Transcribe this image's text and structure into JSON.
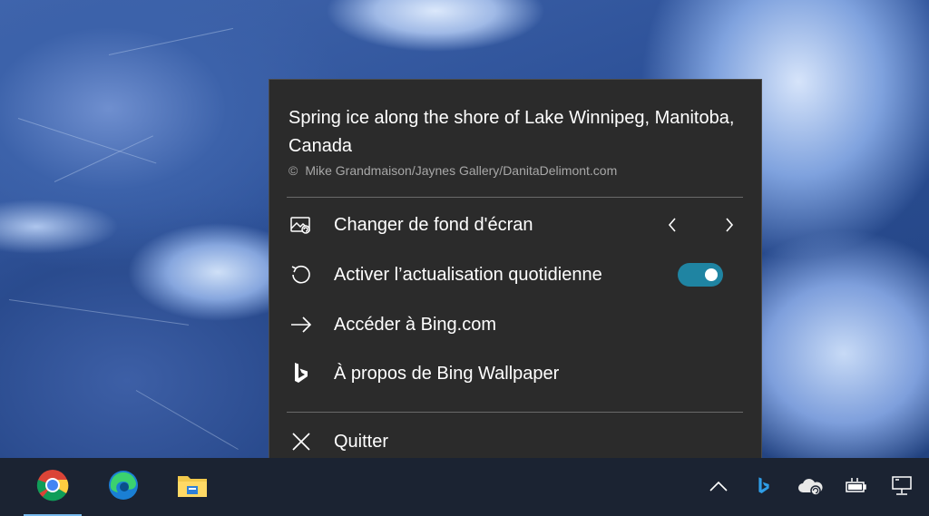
{
  "wallpaper": {
    "description_hidden": true
  },
  "flyout": {
    "caption": "Spring ice along the shore of Lake Winnipeg, Manitoba, Canada",
    "copyright_symbol": "©",
    "copyright": "Mike Grandmaison/Jaynes Gallery/DanitaDelimont.com",
    "items": [
      {
        "label": "Changer de fond d'écran",
        "icon": "change-wallpaper-icon"
      },
      {
        "label": "Activer l’actualisation quotidienne",
        "icon": "refresh-icon",
        "toggle_on": true
      },
      {
        "label": "Accéder à Bing.com",
        "icon": "arrow-right-icon"
      },
      {
        "label": "À propos de Bing Wallpaper",
        "icon": "bing-logo-icon"
      },
      {
        "label": "Quitter",
        "icon": "close-icon"
      }
    ],
    "accent": "#1f84a2"
  },
  "taskbar": {
    "apps": [
      "chrome-icon",
      "edge-icon",
      "file-explorer-icon"
    ],
    "tray": [
      "chevron-up-icon",
      "bing-tray-icon",
      "onedrive-icon",
      "battery-icon",
      "network-icon"
    ]
  }
}
